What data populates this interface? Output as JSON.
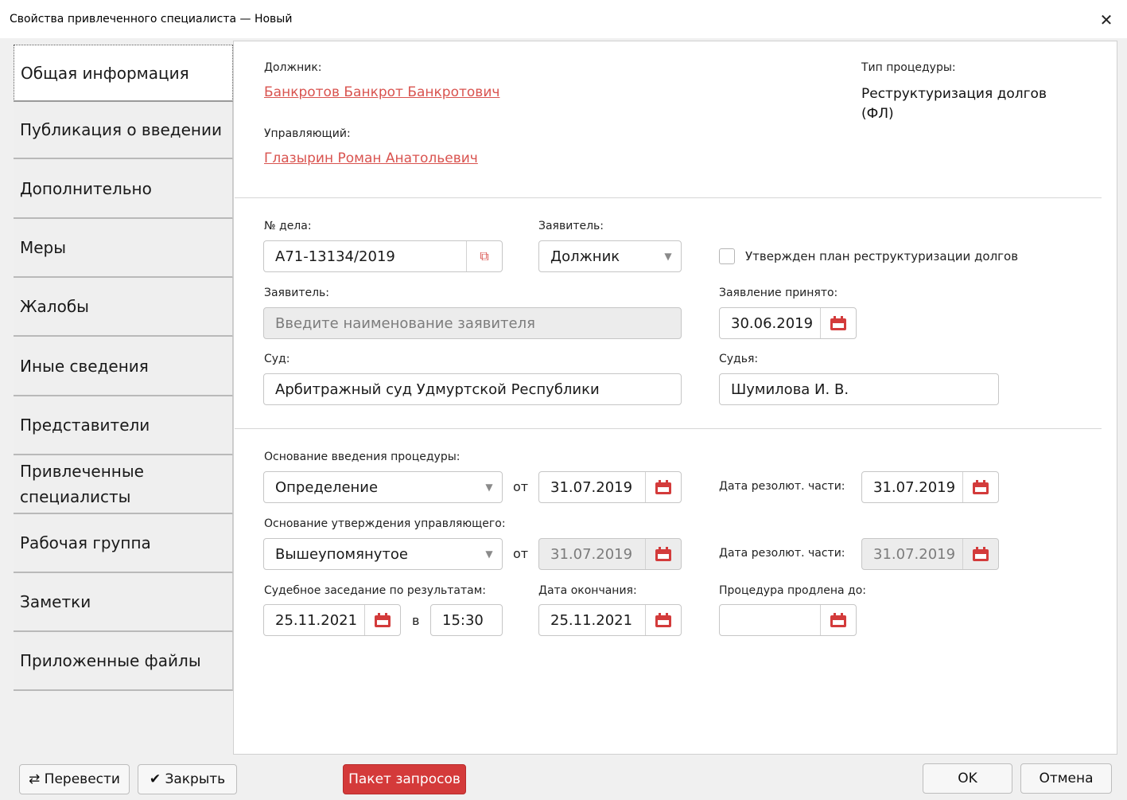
{
  "window": {
    "title": "Свойства привлеченного специалиста — Новый",
    "close_glyph": "✕"
  },
  "tabs": [
    "Общая информация",
    "Публикация о введении",
    "Дополнительно",
    "Меры",
    "Жалобы",
    "Иные сведения",
    "Представители",
    "Привлеченные специалисты",
    "Рабочая группа",
    "Заметки",
    "Приложенные файлы"
  ],
  "top": {
    "debtor_label": "Должник:",
    "debtor_name": "Банкротов Банкрот Банкротович",
    "manager_label": "Управляющий:",
    "manager_name": "Глазырин Роман Анатольевич",
    "procedure_type_label": "Тип процедуры:",
    "procedure_type_value": "Реструктуризация долгов (ФЛ)"
  },
  "case": {
    "case_no_label": "№ дела:",
    "case_no_value": "А71-13134/2019",
    "applicant_label": "Заявитель:",
    "applicant_value": "Должник",
    "plan_approved_label": "Утвержден план реструктуризации долгов",
    "plan_approved_checked": false,
    "applicant_name_label": "Заявитель:",
    "applicant_name_placeholder": "Введите наименование заявителя",
    "statement_accepted_label": "Заявление принято:",
    "statement_accepted_date": "30.06.2019",
    "court_label": "Суд:",
    "court_value": "Арбитражный суд Удмуртской Республики",
    "judge_label": "Судья:",
    "judge_value": "Шумилова И. В."
  },
  "procedure": {
    "basis_intro_label": "Основание введения процедуры:",
    "basis_intro_value": "Определение",
    "from_label": "от",
    "basis_intro_date": "31.07.2019",
    "resolution_label": "Дата резолют. части:",
    "resolution_date_1": "31.07.2019",
    "basis_manager_label": "Основание утверждения управляющего:",
    "basis_manager_value": "Вышеупомянутое",
    "basis_manager_date": "31.07.2019",
    "resolution_date_2": "31.07.2019",
    "hearing_label": "Судебное заседание по результатам:",
    "hearing_date": "25.11.2021",
    "at_label": "в",
    "hearing_time": "15:30",
    "end_date_label": "Дата окончания:",
    "end_date": "25.11.2021",
    "extended_label": "Процедура продлена до:",
    "extended_date": ""
  },
  "footer": {
    "transfer": "⇄ Перевести",
    "close": "✔ Закрыть",
    "request_package": "Пакет запросов",
    "ok": "OK",
    "cancel": "Отмена"
  },
  "colors": {
    "accent_red": "#d33b3b",
    "link_red": "#d9534f"
  }
}
